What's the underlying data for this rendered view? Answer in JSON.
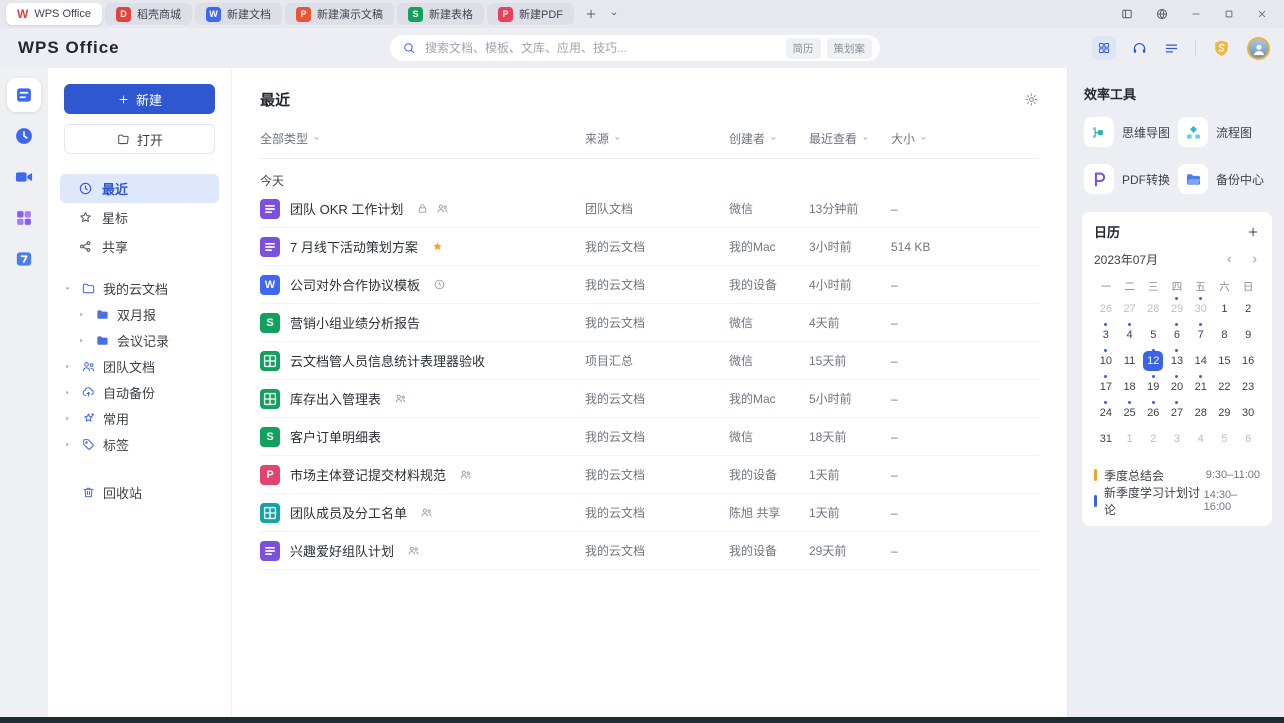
{
  "titlebar": {
    "tabs": [
      {
        "label": "WPS Office",
        "glyph": "W",
        "style": "logo",
        "active": true
      },
      {
        "label": "稻壳商城",
        "glyph": "D",
        "color": "#e2443c"
      },
      {
        "label": "新建文档",
        "glyph": "W",
        "color": "#3e68f2"
      },
      {
        "label": "新建演示文稿",
        "glyph": "P",
        "color": "#ea5537"
      },
      {
        "label": "新建表格",
        "glyph": "S",
        "color": "#16a15b"
      },
      {
        "label": "新建PDF",
        "glyph": "P",
        "color": "#e8415c"
      }
    ],
    "controls": [
      "panel",
      "globe",
      "minus",
      "maxi",
      "close"
    ]
  },
  "header": {
    "logo": "WPS Office",
    "search": {
      "placeholder": "搜索文档、模板、文库、应用、技巧...",
      "tags": [
        "简历",
        "策划案"
      ]
    }
  },
  "rail": {
    "items": [
      {
        "name": "documents",
        "icon": "docFill",
        "color": "#3e68f2",
        "active": true
      },
      {
        "name": "schedule",
        "icon": "clockRail",
        "color": "#3e68f2"
      },
      {
        "name": "meeting",
        "icon": "videoCam",
        "color": "#3e68f2"
      },
      {
        "name": "apps",
        "icon": "appsPurple",
        "color": "#8a5cf0"
      },
      {
        "name": "calendar",
        "icon": "cal7",
        "color": "#4a7df0"
      }
    ]
  },
  "sidebar": {
    "new_label": "新建",
    "open_label": "打开",
    "nav": [
      {
        "label": "最近",
        "icon": "clock",
        "active": true
      },
      {
        "label": "星标",
        "icon": "star"
      },
      {
        "label": "共享",
        "icon": "share"
      }
    ],
    "tree": [
      {
        "label": "我的云文档",
        "icon": "folder",
        "caret": "down",
        "level": 0
      },
      {
        "label": "双月报",
        "icon": "folderFill",
        "caret": "right",
        "level": 1
      },
      {
        "label": "会议记录",
        "icon": "folderFill",
        "caret": "right",
        "level": 1
      },
      {
        "label": "团队文档",
        "icon": "people",
        "caret": "right",
        "level": 0
      },
      {
        "label": "自动备份",
        "icon": "cloudUp",
        "caret": "right",
        "level": 0
      },
      {
        "label": "常用",
        "icon": "pin",
        "caret": "right",
        "level": 0
      },
      {
        "label": "标签",
        "icon": "tag",
        "caret": "right",
        "level": 0
      }
    ],
    "recycle_label": "回收站"
  },
  "main": {
    "title": "最近",
    "filters": [
      "全部类型",
      "来源",
      "创建者",
      "最近查看",
      "大小"
    ],
    "group_label": "今天",
    "rows": [
      {
        "type": "wpsdoc",
        "title": "团队 OKR 工作计划",
        "badges": [
          "lock",
          "people"
        ],
        "source": "团队文档",
        "creator": "微信",
        "viewed": "13分钟前",
        "size": "–"
      },
      {
        "type": "wpsdoc",
        "title": "7 月线下活动策划方案",
        "badges": [
          "star"
        ],
        "source": "我的云文档",
        "creator": "我的Mac",
        "viewed": "3小时前",
        "size": "514 KB"
      },
      {
        "type": "word",
        "title": "公司对外合作协议模板",
        "badges": [
          "history"
        ],
        "source": "我的云文档",
        "creator": "我的设备",
        "viewed": "4小时前",
        "size": "–"
      },
      {
        "type": "sheet",
        "title": "营销小组业绩分析报告",
        "badges": [],
        "source": "我的云文档",
        "creator": "微信",
        "viewed": "4天前",
        "size": "–"
      },
      {
        "type": "grid",
        "title": "云文档管人员信息统计表理器验收",
        "badges": [],
        "source": "项目汇总",
        "creator": "微信",
        "viewed": "15天前",
        "size": "–"
      },
      {
        "type": "grid",
        "title": "库存出入管理表",
        "badges": [
          "people"
        ],
        "source": "我的云文档",
        "creator": "我的Mac",
        "viewed": "5小时前",
        "size": "–"
      },
      {
        "type": "sheet",
        "title": "客户订单明细表",
        "badges": [],
        "source": "我的云文档",
        "creator": "微信",
        "viewed": "18天前",
        "size": "–"
      },
      {
        "type": "pdf",
        "title": "市场主体登记提交材料规范",
        "badges": [
          "people"
        ],
        "source": "我的云文档",
        "creator": "我的设备",
        "viewed": "1天前",
        "size": "–"
      },
      {
        "type": "smart",
        "title": "团队成员及分工名单",
        "badges": [
          "people"
        ],
        "source": "我的云文档",
        "creator": "陈旭 共享",
        "viewed": "1天前",
        "size": "–"
      },
      {
        "type": "wpsdoc",
        "title": "兴趣爱好组队计划",
        "badges": [
          "people"
        ],
        "source": "我的云文档",
        "creator": "我的设备",
        "viewed": "29天前",
        "size": "–"
      }
    ],
    "file_colors": {
      "wpsdoc": "#7c50dd",
      "word": "#3e68f2",
      "sheet": "#12a05f",
      "grid": "#12a05f",
      "pdf": "#e2426b",
      "smart": "#13a5a5"
    }
  },
  "tools": {
    "title": "效率工具",
    "items": [
      {
        "label": "思维导图",
        "icon": "mindmap"
      },
      {
        "label": "流程图",
        "icon": "flowchart"
      },
      {
        "label": "PDF转换",
        "icon": "pdfConv"
      },
      {
        "label": "备份中心",
        "icon": "backupFolder"
      }
    ]
  },
  "calendar": {
    "title": "日历",
    "month": "2023年07月",
    "weekdays": [
      "一",
      "二",
      "三",
      "四",
      "五",
      "六",
      "日"
    ],
    "days": [
      {
        "d": 26,
        "muted": true
      },
      {
        "d": 27,
        "muted": true
      },
      {
        "d": 28,
        "muted": true
      },
      {
        "d": 29,
        "muted": true,
        "dot": true
      },
      {
        "d": 30,
        "muted": true,
        "dot": true
      },
      {
        "d": 1
      },
      {
        "d": 2
      },
      {
        "d": 3,
        "dot": true
      },
      {
        "d": 4,
        "dot": true
      },
      {
        "d": 5
      },
      {
        "d": 6,
        "dot": true
      },
      {
        "d": 7,
        "dot": true
      },
      {
        "d": 8
      },
      {
        "d": 9
      },
      {
        "d": 10,
        "dot": true
      },
      {
        "d": 11
      },
      {
        "d": 12,
        "selected": true,
        "dot": true
      },
      {
        "d": 13,
        "dot": true
      },
      {
        "d": 14
      },
      {
        "d": 15
      },
      {
        "d": 16
      },
      {
        "d": 17,
        "dot": true
      },
      {
        "d": 18
      },
      {
        "d": 19,
        "dot": true
      },
      {
        "d": 20,
        "dot": true
      },
      {
        "d": 21,
        "dot": true
      },
      {
        "d": 22
      },
      {
        "d": 23
      },
      {
        "d": 24,
        "dot": true
      },
      {
        "d": 25,
        "dot": true
      },
      {
        "d": 26,
        "dot": true
      },
      {
        "d": 27,
        "dot": true
      },
      {
        "d": 28
      },
      {
        "d": 29
      },
      {
        "d": 30
      },
      {
        "d": 31
      },
      {
        "d": 1,
        "muted": true
      },
      {
        "d": 2,
        "muted": true
      },
      {
        "d": 3,
        "muted": true
      },
      {
        "d": 4,
        "muted": true
      },
      {
        "d": 5,
        "muted": true
      },
      {
        "d": 6,
        "muted": true
      }
    ],
    "events": [
      {
        "title": "季度总结会",
        "time": "9:30–11:00",
        "color": "#f0a32f"
      },
      {
        "title": "新季度学习计划讨论",
        "time": "14:30–16:00",
        "color": "#3b63e8"
      }
    ]
  }
}
